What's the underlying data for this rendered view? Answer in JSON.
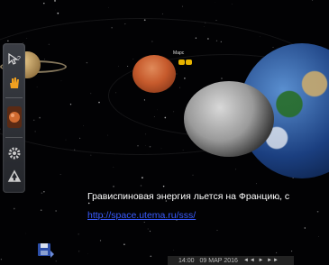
{
  "caption": "Грависпиновая энергия льется на Францию, с",
  "link": "http://space.utema.ru/sss/",
  "mars_label": "Марс",
  "time_bar": {
    "time": "14:00",
    "date": "09 МАР 2016",
    "controls": "◄◄ ► ►►"
  },
  "toolbar": {
    "tools": [
      {
        "icon": "pointer-help-icon"
      },
      {
        "icon": "hand-icon"
      },
      {
        "icon": "planet-icon"
      },
      {
        "icon": "gear-icon"
      },
      {
        "icon": "tools-icon"
      }
    ]
  },
  "colors": {
    "link": "#3a5cff",
    "mars": "#c65a2c",
    "toolbar": "#2c2f35"
  }
}
